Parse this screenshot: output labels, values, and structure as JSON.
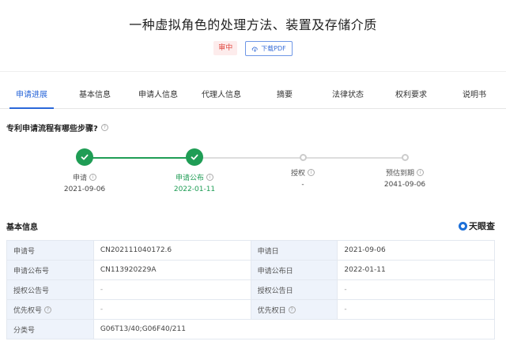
{
  "header": {
    "title": "一种虚拟角色的处理方法、装置及存储介质",
    "status_badge": "审中",
    "pdf_button": "下载PDF"
  },
  "tabs": [
    {
      "label": "申请进展",
      "active": true
    },
    {
      "label": "基本信息"
    },
    {
      "label": "申请人信息"
    },
    {
      "label": "代理人信息"
    },
    {
      "label": "摘要"
    },
    {
      "label": "法律状态"
    },
    {
      "label": "权利要求"
    },
    {
      "label": "说明书"
    }
  ],
  "progress": {
    "question": "专利申请流程有哪些步骤?",
    "steps": [
      {
        "label": "申请",
        "date": "2021-09-06",
        "done": true
      },
      {
        "label": "申请公布",
        "date": "2022-01-11",
        "done": true
      },
      {
        "label": "授权",
        "date": "-",
        "done": false
      },
      {
        "label": "预估到期",
        "date": "2041-09-06",
        "done": false
      }
    ]
  },
  "basic": {
    "title": "基本信息",
    "brand": "天眼查",
    "rows": [
      {
        "k1": "申请号",
        "v1": "CN202111040172.6",
        "k2": "申请日",
        "v2": "2021-09-06"
      },
      {
        "k1": "申请公布号",
        "v1": "CN113920229A",
        "k2": "申请公布日",
        "v2": "2022-01-11"
      },
      {
        "k1": "授权公告号",
        "v1": "-",
        "k2": "授权公告日",
        "v2": "-"
      },
      {
        "k1": "优先权号",
        "v1": "-",
        "k2": "优先权日",
        "v2": "-"
      },
      {
        "k1": "分类号",
        "v1": "G06T13/40;G06F40/211"
      }
    ]
  },
  "colors": {
    "accent": "#2a67d9",
    "done": "#1f9d55",
    "status": "#e0473f"
  }
}
